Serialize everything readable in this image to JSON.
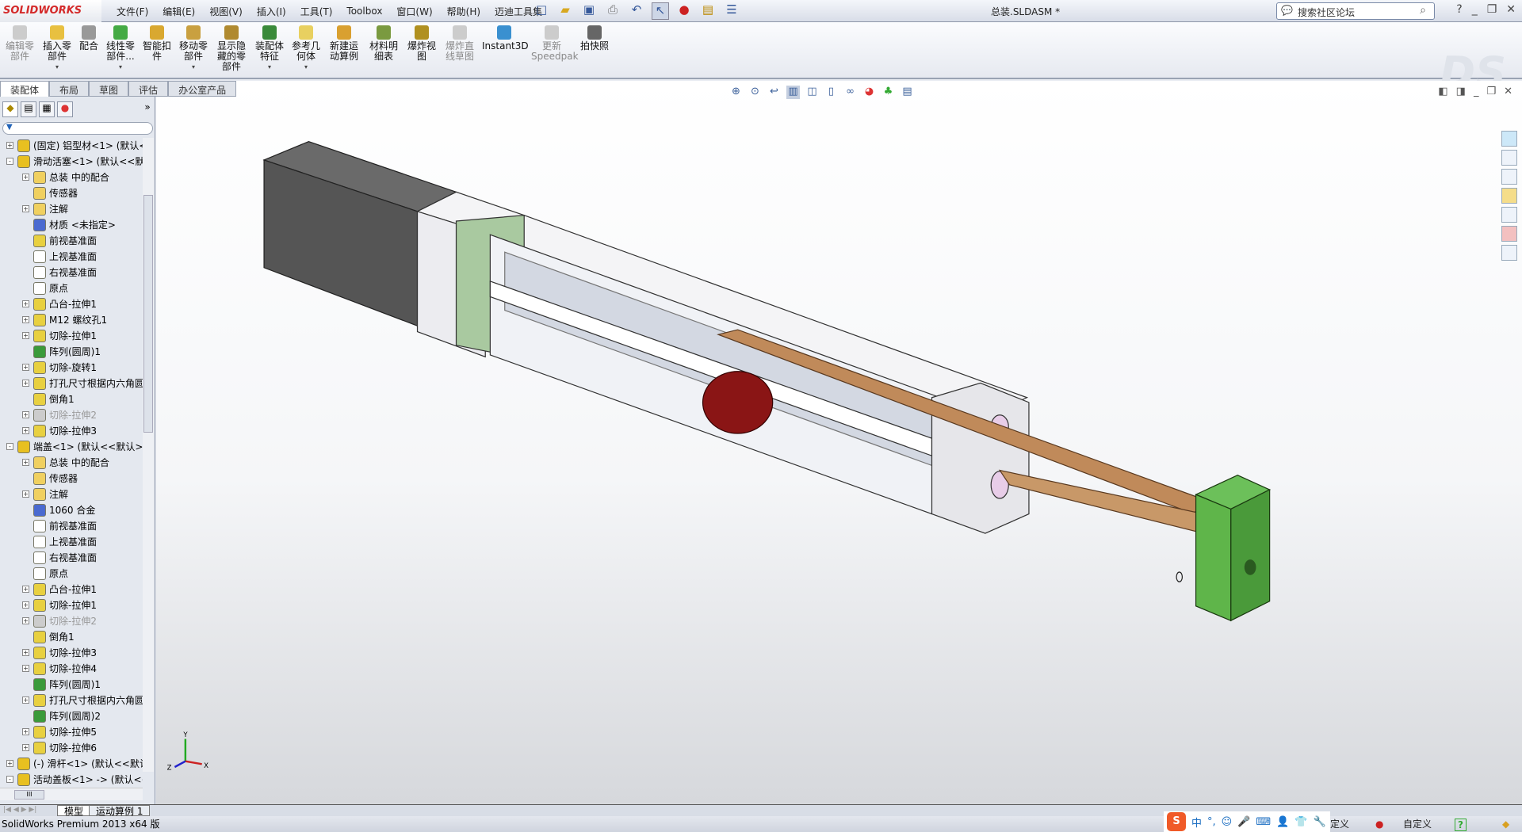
{
  "app": {
    "logo": "SOLIDWORKS",
    "document_title": "总装.SLDASM *"
  },
  "menu": [
    "文件(F)",
    "编辑(E)",
    "视图(V)",
    "插入(I)",
    "工具(T)",
    "Toolbox",
    "窗口(W)",
    "帮助(H)",
    "迈迪工具集"
  ],
  "search": {
    "placeholder": "搜索社区论坛"
  },
  "command_manager": [
    {
      "label": "编辑零部件",
      "disabled": true
    },
    {
      "label": "插入零部件",
      "dropdown": true
    },
    {
      "label": "配合"
    },
    {
      "label": "线性零部件...",
      "dropdown": true
    },
    {
      "label": "智能扣件"
    },
    {
      "label": "移动零部件",
      "dropdown": true
    },
    {
      "label": "显示隐藏的零部件"
    },
    {
      "label": "装配体特征",
      "dropdown": true
    },
    {
      "label": "参考几何体",
      "dropdown": true
    },
    {
      "label": "新建运动算例"
    },
    {
      "label": "材料明细表"
    },
    {
      "label": "爆炸视图"
    },
    {
      "label": "爆炸直线草图",
      "disabled": true
    },
    {
      "label": "Instant3D"
    },
    {
      "label": "更新Speedpak",
      "disabled": true
    },
    {
      "label": "拍快照"
    }
  ],
  "tabs": [
    "装配体",
    "布局",
    "草图",
    "评估",
    "办公室产品"
  ],
  "tree": [
    {
      "lvl": 0,
      "ex": "+",
      "icon": "assembly",
      "label": "(固定) 铝型材<1> (默认<"
    },
    {
      "lvl": 0,
      "ex": "-",
      "icon": "assembly",
      "label": "滑动活塞<1> (默认<<默"
    },
    {
      "lvl": 1,
      "ex": "+",
      "icon": "mates",
      "label": "总装 中的配合"
    },
    {
      "lvl": 1,
      "ex": "",
      "icon": "sensor",
      "label": "传感器"
    },
    {
      "lvl": 1,
      "ex": "+",
      "icon": "annotation",
      "label": "注解"
    },
    {
      "lvl": 1,
      "ex": "",
      "icon": "material",
      "label": "材质 <未指定>"
    },
    {
      "lvl": 1,
      "ex": "",
      "icon": "plane-selected",
      "label": "前视基准面"
    },
    {
      "lvl": 1,
      "ex": "",
      "icon": "plane",
      "label": "上视基准面"
    },
    {
      "lvl": 1,
      "ex": "",
      "icon": "plane",
      "label": "右视基准面"
    },
    {
      "lvl": 1,
      "ex": "",
      "icon": "origin",
      "label": "原点"
    },
    {
      "lvl": 1,
      "ex": "+",
      "icon": "boss",
      "label": "凸台-拉伸1"
    },
    {
      "lvl": 1,
      "ex": "+",
      "icon": "hole",
      "label": "M12 螺纹孔1"
    },
    {
      "lvl": 1,
      "ex": "+",
      "icon": "cut",
      "label": "切除-拉伸1"
    },
    {
      "lvl": 1,
      "ex": "",
      "icon": "pattern",
      "label": "阵列(圆周)1"
    },
    {
      "lvl": 1,
      "ex": "+",
      "icon": "revolve",
      "label": "切除-旋转1"
    },
    {
      "lvl": 1,
      "ex": "+",
      "icon": "hole",
      "label": "打孔尺寸根据内六角圆"
    },
    {
      "lvl": 1,
      "ex": "",
      "icon": "chamfer",
      "label": "倒角1"
    },
    {
      "lvl": 1,
      "ex": "+",
      "icon": "cut-suppressed",
      "label": "切除-拉伸2",
      "grey": true
    },
    {
      "lvl": 1,
      "ex": "+",
      "icon": "cut",
      "label": "切除-拉伸3"
    },
    {
      "lvl": 0,
      "ex": "-",
      "icon": "assembly",
      "label": "端盖<1> (默认<<默认>_"
    },
    {
      "lvl": 1,
      "ex": "+",
      "icon": "mates",
      "label": "总装 中的配合"
    },
    {
      "lvl": 1,
      "ex": "",
      "icon": "sensor",
      "label": "传感器"
    },
    {
      "lvl": 1,
      "ex": "+",
      "icon": "annotation",
      "label": "注解"
    },
    {
      "lvl": 1,
      "ex": "",
      "icon": "material",
      "label": "1060 合金"
    },
    {
      "lvl": 1,
      "ex": "",
      "icon": "plane",
      "label": "前视基准面"
    },
    {
      "lvl": 1,
      "ex": "",
      "icon": "plane",
      "label": "上视基准面"
    },
    {
      "lvl": 1,
      "ex": "",
      "icon": "plane",
      "label": "右视基准面"
    },
    {
      "lvl": 1,
      "ex": "",
      "icon": "origin",
      "label": "原点"
    },
    {
      "lvl": 1,
      "ex": "+",
      "icon": "boss",
      "label": "凸台-拉伸1"
    },
    {
      "lvl": 1,
      "ex": "+",
      "icon": "cut",
      "label": "切除-拉伸1"
    },
    {
      "lvl": 1,
      "ex": "+",
      "icon": "cut-suppressed",
      "label": "切除-拉伸2",
      "grey": true
    },
    {
      "lvl": 1,
      "ex": "",
      "icon": "chamfer",
      "label": "倒角1"
    },
    {
      "lvl": 1,
      "ex": "+",
      "icon": "cut",
      "label": "切除-拉伸3"
    },
    {
      "lvl": 1,
      "ex": "+",
      "icon": "cut",
      "label": "切除-拉伸4"
    },
    {
      "lvl": 1,
      "ex": "",
      "icon": "pattern",
      "label": "阵列(圆周)1"
    },
    {
      "lvl": 1,
      "ex": "+",
      "icon": "hole",
      "label": "打孔尺寸根据内六角圆"
    },
    {
      "lvl": 1,
      "ex": "",
      "icon": "pattern",
      "label": "阵列(圆周)2"
    },
    {
      "lvl": 1,
      "ex": "+",
      "icon": "cut",
      "label": "切除-拉伸5"
    },
    {
      "lvl": 1,
      "ex": "+",
      "icon": "cut",
      "label": "切除-拉伸6"
    },
    {
      "lvl": 0,
      "ex": "+",
      "icon": "assembly",
      "label": "(-) 滑杆<1> (默认<<默认"
    },
    {
      "lvl": 0,
      "ex": "-",
      "icon": "assembly",
      "label": "活动盖板<1> -> (默认<<"
    }
  ],
  "bottom_tabs": [
    "模型",
    "运动算例 1"
  ],
  "hscroll_label": "III",
  "status": {
    "left": "SolidWorks Premium 2013 x64 版",
    "units_partial": "定义",
    "custom": "自定义",
    "ime": {
      "logo": "S",
      "lang": "中",
      "punct": "°,"
    }
  },
  "triad": {
    "x": "X",
    "y": "Y",
    "z": "Z"
  },
  "colors": {
    "accent": "#d42a2a",
    "body": "#f2f2f4",
    "green": "#5fb54a",
    "copper": "#c08a5a",
    "red": "#8a1515"
  }
}
